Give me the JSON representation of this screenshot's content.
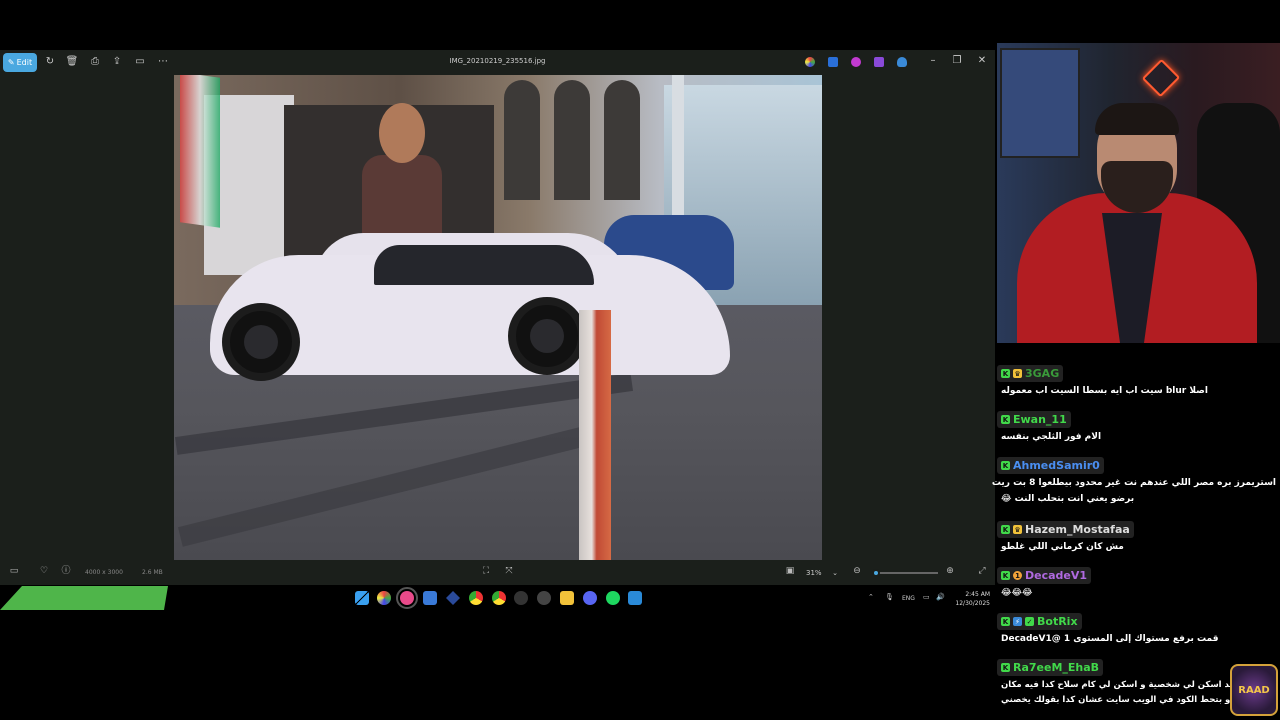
{
  "photos_app": {
    "edit_label": "Edit",
    "filename": "IMG_20210219_235516.jpg",
    "dimensions": "4000 x 3000",
    "file_size": "2.6 MB",
    "zoom_level": "31%",
    "zoom_fraction": 0.05
  },
  "taskbar": {
    "language": "ENG",
    "time": "2:45 AM",
    "date": "12/30/2025"
  },
  "chat": {
    "messages": [
      {
        "user": "3GAG",
        "color": "#3a9a3a",
        "text": "اصلا blur سيت اب ايه بسطا السيت اب معموله"
      },
      {
        "user": "Ewan_11",
        "color": "#41d94a",
        "text": "الام فور الثلجي بنفسه"
      },
      {
        "user": "AhmedSamir0",
        "color": "#4a8ef0",
        "text": "استريمرز بره مصر اللي عندهم نت غير محدود بيطلعوا 8 بت ريت"
      },
      {
        "user": "",
        "color": "",
        "text": "برضو يعني انت بتحلب النت 😂"
      },
      {
        "user": "Hazem_Mostafaa",
        "color": "#ddd",
        "text": "مش كان كرماني اللي غلطو"
      },
      {
        "user": "DecadeV1",
        "color": "#b06ae0",
        "text": "😂😂😂"
      },
      {
        "user": "BotRix",
        "color": "#41d94a",
        "text": "قمت برفع مستواك إلى المستوى 1 @DecadeV1"
      },
      {
        "user": "Ra7eeM_EhaB",
        "color": "#41d94a",
        "text": "يعني بيتاخد اسكن لي شخصية و اسكن لي كام سلاح كدا فيه مكان"
      },
      {
        "user": "",
        "color": "",
        "text": "الخروش و بتحط الكود في الويب سايت عشان كدا بقولك يخصني"
      }
    ]
  },
  "logo_text": "RAAD"
}
